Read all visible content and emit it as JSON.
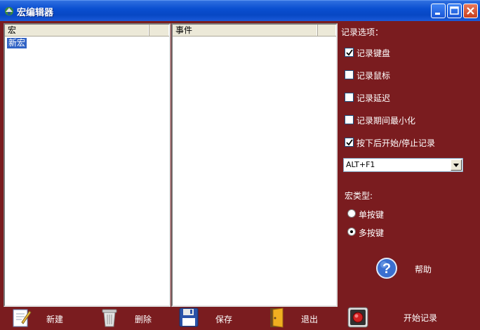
{
  "window": {
    "title": "宏编辑器",
    "icons": {
      "app": "macro-app-icon",
      "minimize": "minimize-icon",
      "maximize": "maximize-icon",
      "close": "close-icon"
    }
  },
  "macro_list": {
    "column": "宏",
    "items": [
      "新宏"
    ]
  },
  "event_list": {
    "column": "事件"
  },
  "options": {
    "heading": "记录选项：",
    "record_keyboard": {
      "label": "记录键盘",
      "checked": true
    },
    "record_mouse": {
      "label": "记录鼠标",
      "checked": false
    },
    "record_delay": {
      "label": "记录延迟",
      "checked": false
    },
    "minimize_while_recording": {
      "label": "记录期间最小化",
      "checked": false
    },
    "hotkey_toggle": {
      "label": "按下后开始/停止记录",
      "checked": true
    },
    "hotkey_value": "ALT+F1"
  },
  "macro_type": {
    "heading": "宏类型:",
    "single_key": {
      "label": "单按键",
      "selected": false
    },
    "multi_key": {
      "label": "多按键",
      "selected": true
    }
  },
  "help": {
    "label": "帮助",
    "icon": "help-icon"
  },
  "toolbar": {
    "new": {
      "label": "新建",
      "icon": "new-document-icon"
    },
    "delete": {
      "label": "删除",
      "icon": "trash-icon"
    },
    "save": {
      "label": "保存",
      "icon": "floppy-disk-icon"
    },
    "exit": {
      "label": "退出",
      "icon": "exit-door-icon"
    },
    "start_record": {
      "label": "开始记录",
      "icon": "record-icon"
    }
  },
  "colors": {
    "background": "#7a1c1f",
    "titlebar": "#0a4fd0",
    "selection": "#3163c5"
  }
}
